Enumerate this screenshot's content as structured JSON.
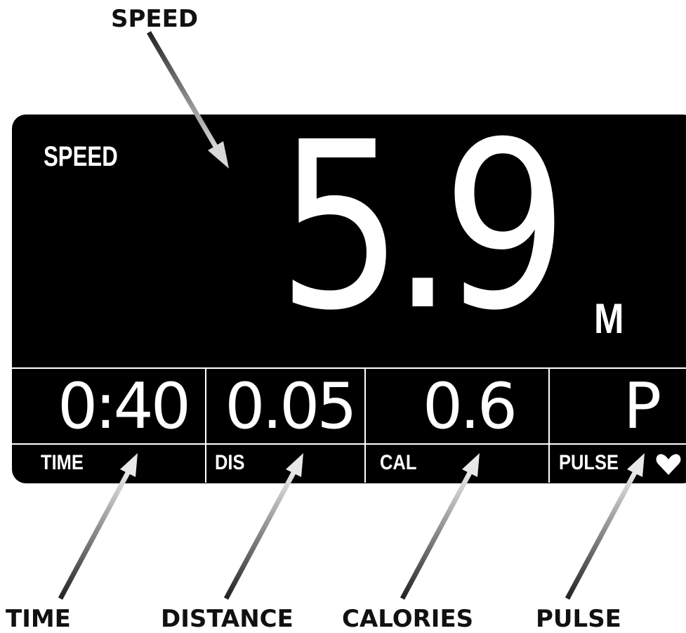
{
  "callouts": {
    "speed": "SPEED",
    "time": "TIME",
    "distance": "DISTANCE",
    "calories": "CALORIES",
    "pulse": "PULSE"
  },
  "display": {
    "speed_label": "SPEED",
    "speed_value": "5.9",
    "speed_unit": "M",
    "cells": [
      {
        "value": "0:40",
        "label": "TIME"
      },
      {
        "value": "0.05",
        "label": "DIS"
      },
      {
        "value": "0.6",
        "label": "CAL"
      },
      {
        "value": "P",
        "label": "PULSE"
      }
    ],
    "heart_icon": "heart-icon"
  },
  "colors": {
    "display_background": "#000000",
    "display_text": "#ffffff",
    "callout_text": "#111111"
  }
}
